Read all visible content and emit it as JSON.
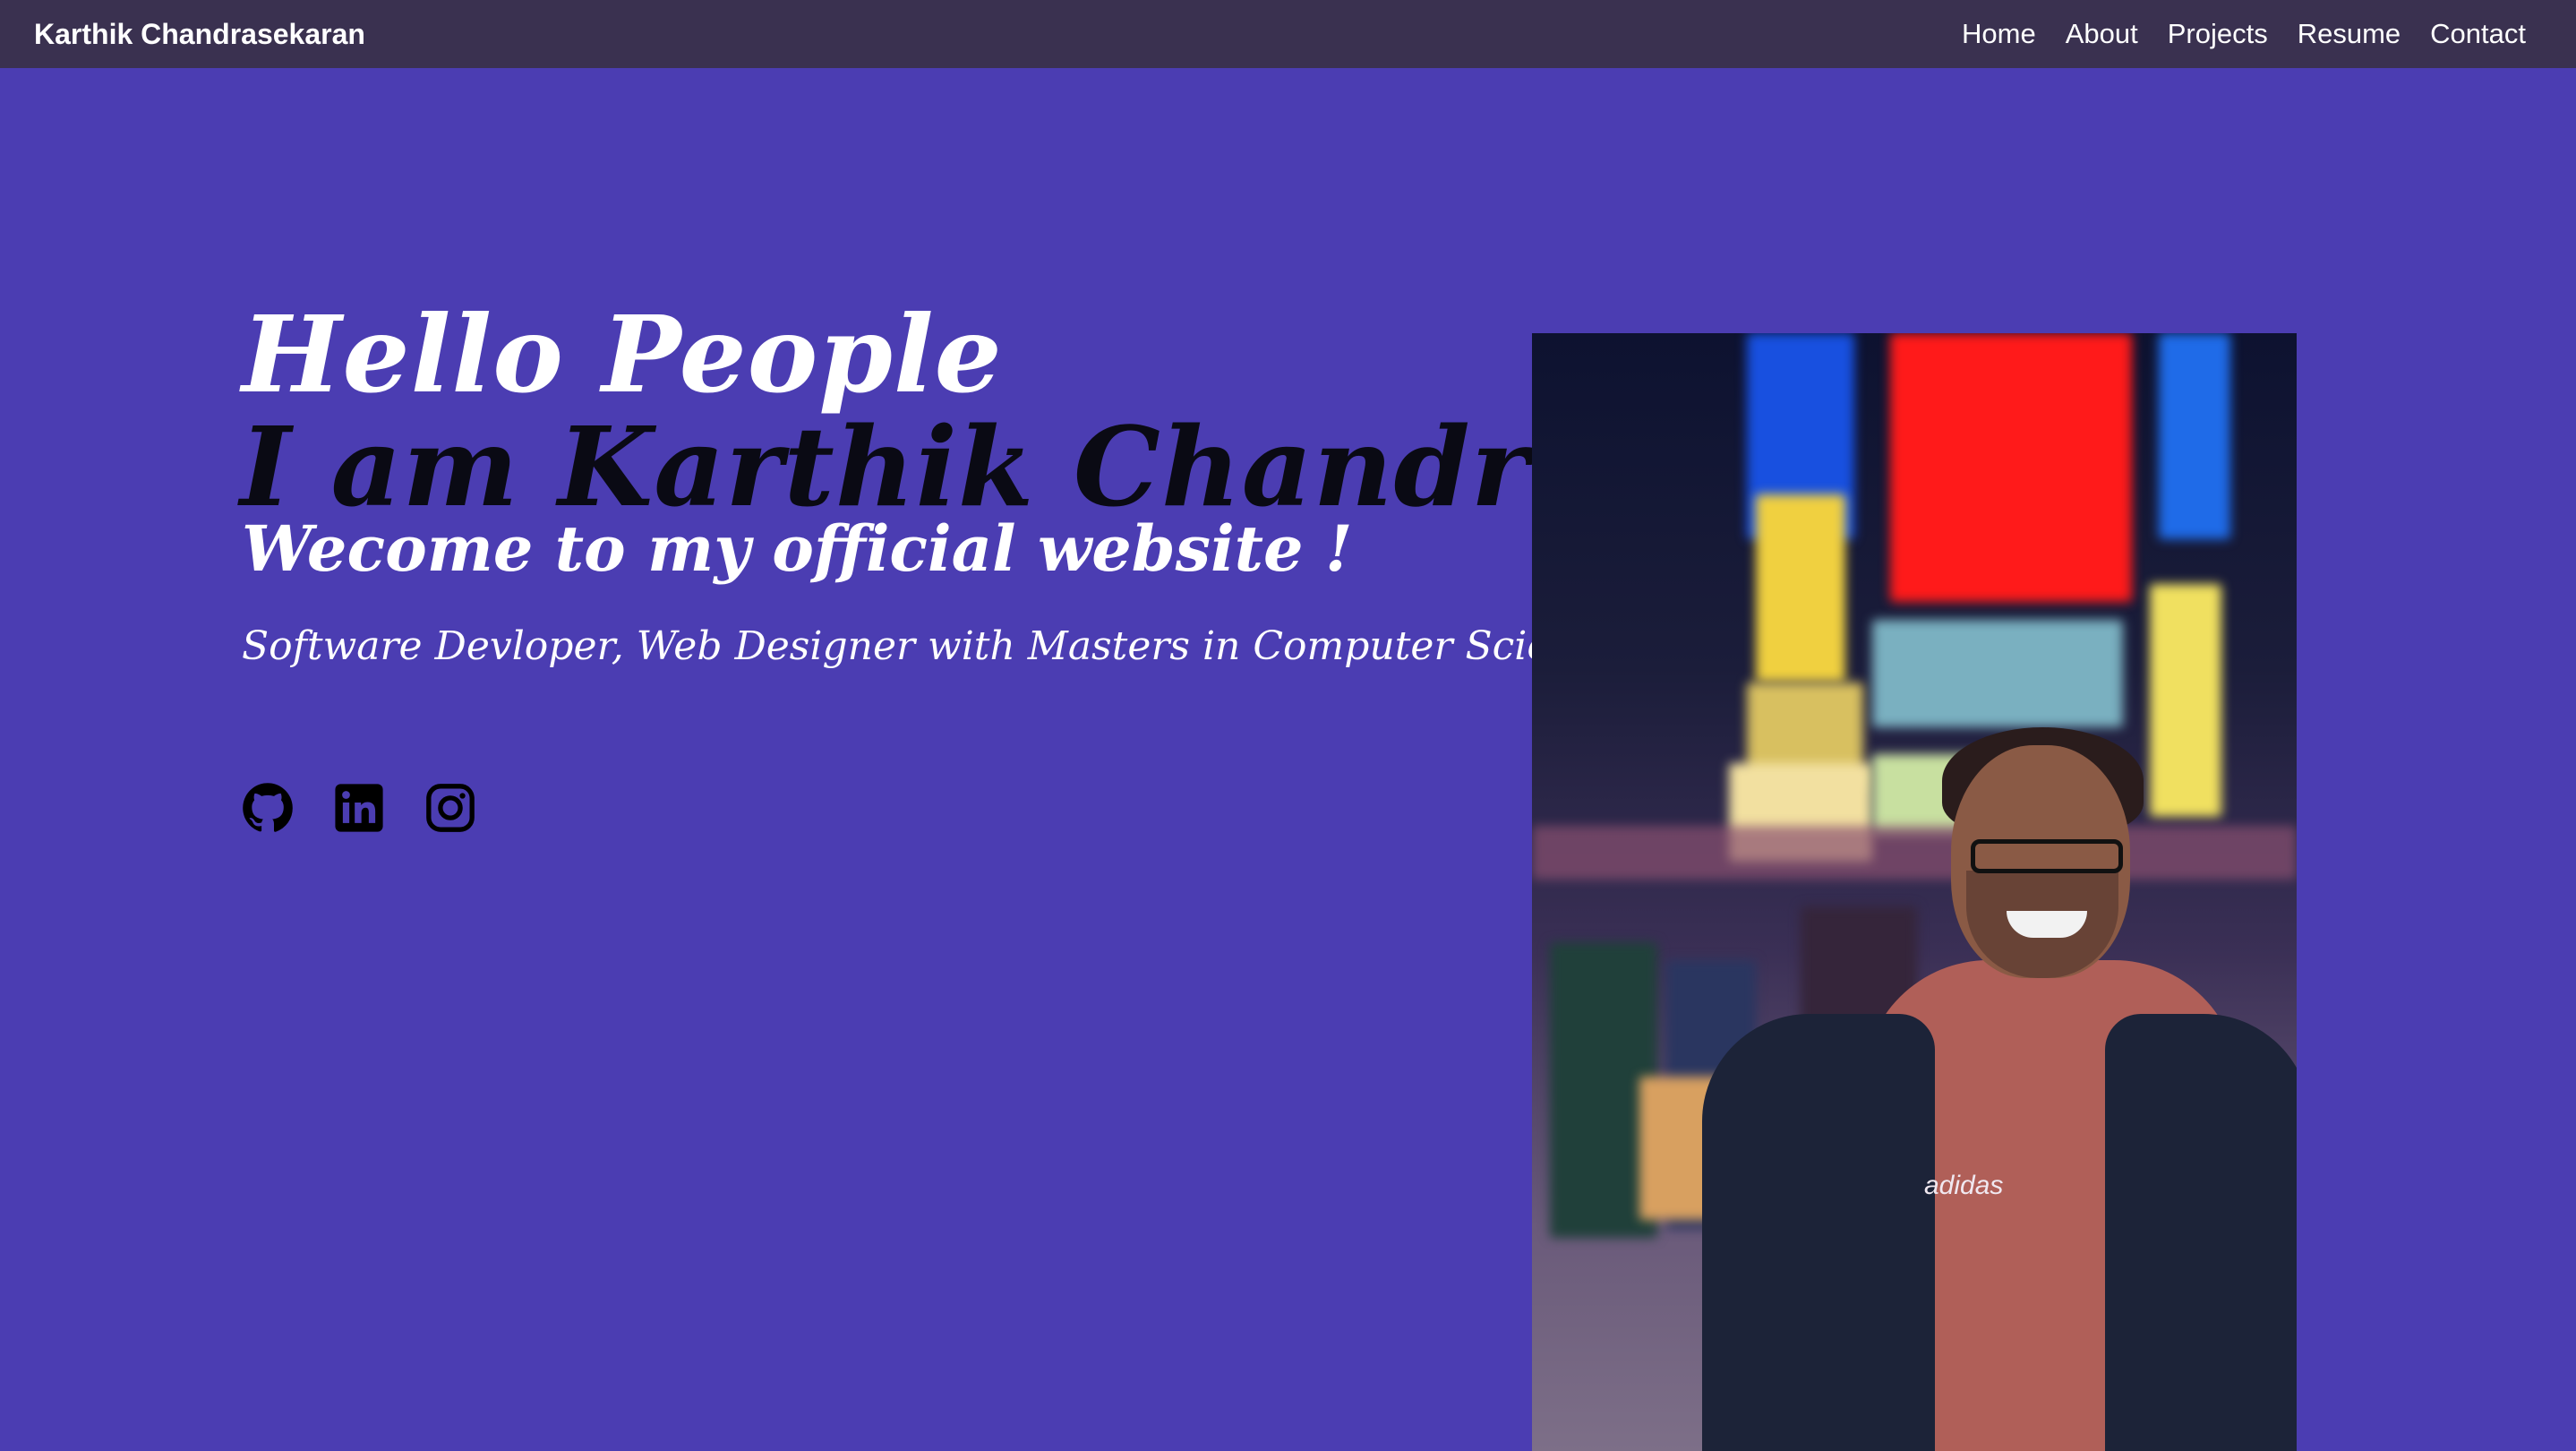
{
  "navbar": {
    "brand": "Karthik Chandrasekaran",
    "links": [
      "Home",
      "About",
      "Projects",
      "Resume",
      "Contact"
    ]
  },
  "hero": {
    "greeting": "Hello People",
    "intro": "I am Karthik Chandrasekaran",
    "welcome": "Wecome to my official website !",
    "tagline": "Software Devloper, Web Designer with Masters in Computer Science.",
    "socials": [
      {
        "icon": "github-icon"
      },
      {
        "icon": "linkedin-icon"
      },
      {
        "icon": "instagram-icon"
      }
    ],
    "photo_logo": "adidas"
  },
  "colors": {
    "background": "#4b3db2",
    "navbar": "#3a3150",
    "heading_white": "#ffffff",
    "heading_dark": "#0a0a14"
  }
}
